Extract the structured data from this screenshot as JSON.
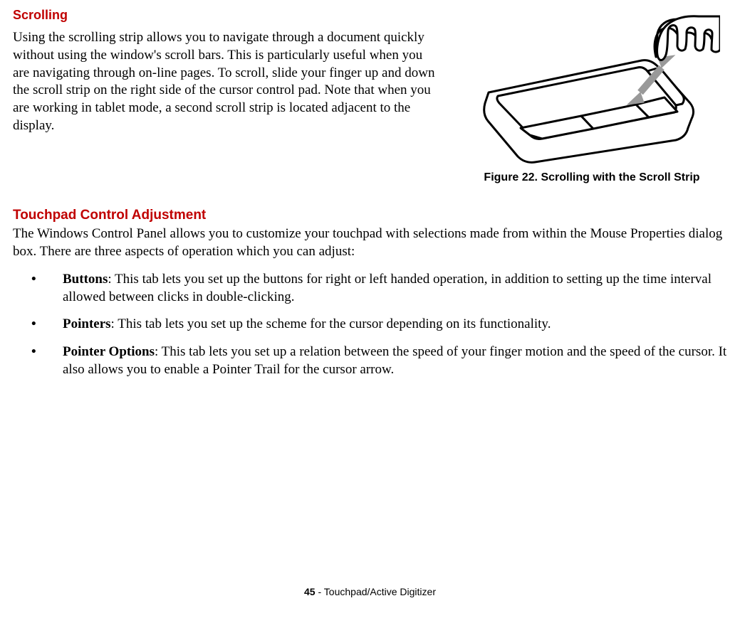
{
  "section1": {
    "heading": "Scrolling",
    "body": "Using the scrolling strip allows you to navigate through a document quickly without using the window's scroll bars. This is particularly useful when you are navigating through on-line pages. To scroll, slide your finger up and down the scroll strip on the right side of the cursor control pad. Note that when you are working in tablet mode, a second scroll strip is located adjacent to the display."
  },
  "figure": {
    "caption": "Figure 22.  Scrolling with the Scroll Strip"
  },
  "section2": {
    "heading": "Touchpad Control Adjustment",
    "intro": "The Windows Control Panel allows you to customize your touchpad with selections made from within the Mouse Properties dialog box. There are three aspects of operation which you can adjust:",
    "bullets": [
      {
        "term": "Buttons",
        "desc": ": This tab lets you set up the buttons for right or left handed operation, in addition to setting up the time interval allowed between clicks in double-clicking."
      },
      {
        "term": "Pointers",
        "desc": ": This tab lets you set up the scheme for the cursor depending on its functionality."
      },
      {
        "term": "Pointer Options",
        "desc": ": This tab lets you set up a relation between the speed of your finger motion and the speed of the cursor. It also allows you to enable a Pointer Trail for the cursor arrow."
      }
    ]
  },
  "footer": {
    "page": "45",
    "sep": " - ",
    "title": "Touchpad/Active Digitizer"
  }
}
